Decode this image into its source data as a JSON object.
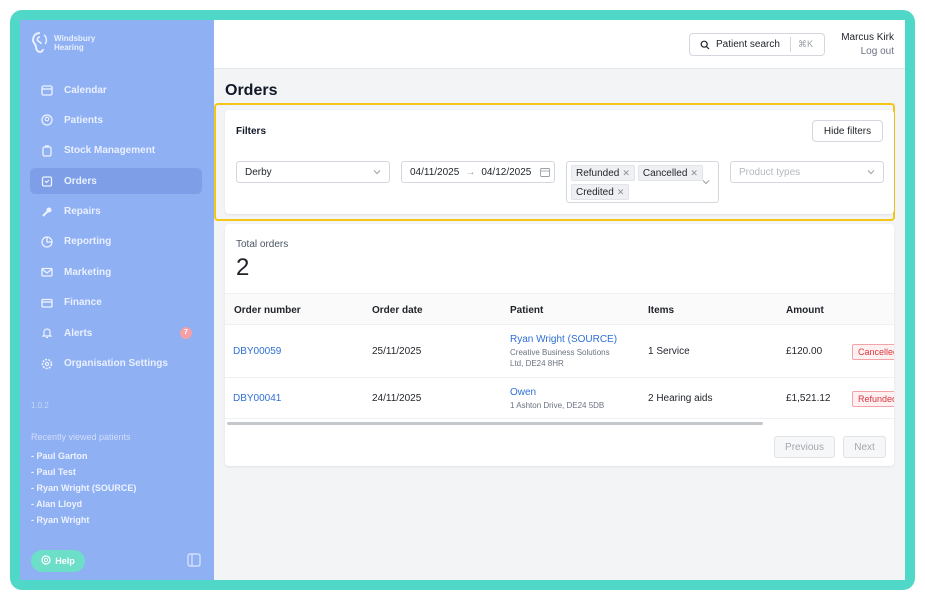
{
  "sidebar": {
    "logo_line1": "Windsbury",
    "logo_line2": "Hearing",
    "items": [
      {
        "label": "Calendar",
        "icon": "calendar-icon"
      },
      {
        "label": "Patients",
        "icon": "patients-icon"
      },
      {
        "label": "Stock Management",
        "icon": "stock-icon"
      },
      {
        "label": "Orders",
        "icon": "orders-icon",
        "active": true
      },
      {
        "label": "Repairs",
        "icon": "wrench-icon"
      },
      {
        "label": "Reporting",
        "icon": "pie-chart-icon"
      },
      {
        "label": "Marketing",
        "icon": "mail-icon"
      },
      {
        "label": "Finance",
        "icon": "credit-card-icon"
      },
      {
        "label": "Alerts",
        "icon": "bell-icon",
        "badge": "7"
      },
      {
        "label": "Organisation Settings",
        "icon": "gear-icon"
      }
    ],
    "version": "1.0.2",
    "recent_title": "Recently viewed patients",
    "recent": [
      "- Paul Garton",
      "- Paul Test",
      "- Ryan Wright (SOURCE)",
      "- Alan Lloyd",
      "- Ryan Wright"
    ],
    "help_label": "Help"
  },
  "topbar": {
    "search_label": "Patient search",
    "search_shortcut": "⌘K",
    "user_name": "Marcus Kirk",
    "logout_label": "Log out"
  },
  "page_title": "Orders",
  "filters": {
    "title": "Filters",
    "hide_label": "Hide filters",
    "location": "Derby",
    "date_from": "04/11/2025",
    "date_to": "04/12/2025",
    "statuses": [
      "Refunded",
      "Cancelled",
      "Credited"
    ],
    "product_types_placeholder": "Product types"
  },
  "orders": {
    "total_label": "Total orders",
    "total_value": "2",
    "columns": [
      "Order number",
      "Order date",
      "Patient",
      "Items",
      "Amount"
    ],
    "rows": [
      {
        "order_number": "DBY00059",
        "date": "25/11/2025",
        "patient_name": "Ryan Wright (SOURCE)",
        "patient_detail_1": "Creative Business Solutions",
        "patient_detail_2": "Ltd, DE24 8HR",
        "items": "1 Service",
        "amount": "£120.00",
        "status": "Cancelled"
      },
      {
        "order_number": "DBY00041",
        "date": "24/11/2025",
        "patient_name": "Owen",
        "patient_detail_1": "1 Ashton Drive, DE24 5DB",
        "patient_detail_2": "",
        "items": "2 Hearing aids",
        "amount": "£1,521.12",
        "status": "Refunded"
      }
    ],
    "previous_label": "Previous",
    "next_label": "Next"
  },
  "colors": {
    "frame": "#4fd8c8",
    "sidebar": "#8fb0f3",
    "highlight": "#f5c518",
    "link": "#2f6fd6",
    "danger": "#d9363e"
  }
}
